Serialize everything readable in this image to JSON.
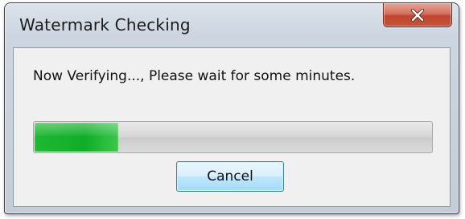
{
  "window": {
    "title": "Watermark Checking",
    "close_icon": "close-icon"
  },
  "dialog": {
    "message": "Now Verifying..., Please wait for some minutes.",
    "progress_fraction": 0.21,
    "cancel_label": "Cancel"
  },
  "colors": {
    "progress_fill": "#12b02b",
    "close_button": "#c9523a",
    "cancel_border": "#3c7fb1"
  }
}
